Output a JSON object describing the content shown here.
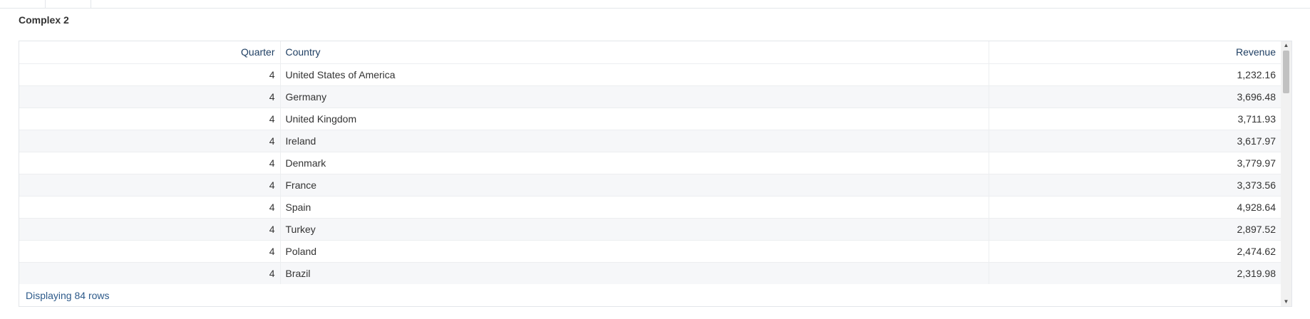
{
  "panel": {
    "title": "Complex 2"
  },
  "table": {
    "columns": [
      "Quarter",
      "Country",
      "Revenue"
    ],
    "rows": [
      [
        "4",
        "United States of America",
        "1,232.16"
      ],
      [
        "4",
        "Germany",
        "3,696.48"
      ],
      [
        "4",
        "United Kingdom",
        "3,711.93"
      ],
      [
        "4",
        "Ireland",
        "3,617.97"
      ],
      [
        "4",
        "Denmark",
        "3,779.97"
      ],
      [
        "4",
        "France",
        "3,373.56"
      ],
      [
        "4",
        "Spain",
        "4,928.64"
      ],
      [
        "4",
        "Turkey",
        "2,897.52"
      ],
      [
        "4",
        "Poland",
        "2,474.62"
      ],
      [
        "4",
        "Brazil",
        "2,319.98"
      ]
    ]
  },
  "footer": {
    "status": "Displaying 84 rows"
  },
  "scrollbar": {
    "up_glyph": "▲",
    "down_glyph": "▼"
  },
  "colors": {
    "header_text": "#1f3f63",
    "footer_text": "#2d5a8a",
    "row_alt": "#f6f7f9"
  }
}
